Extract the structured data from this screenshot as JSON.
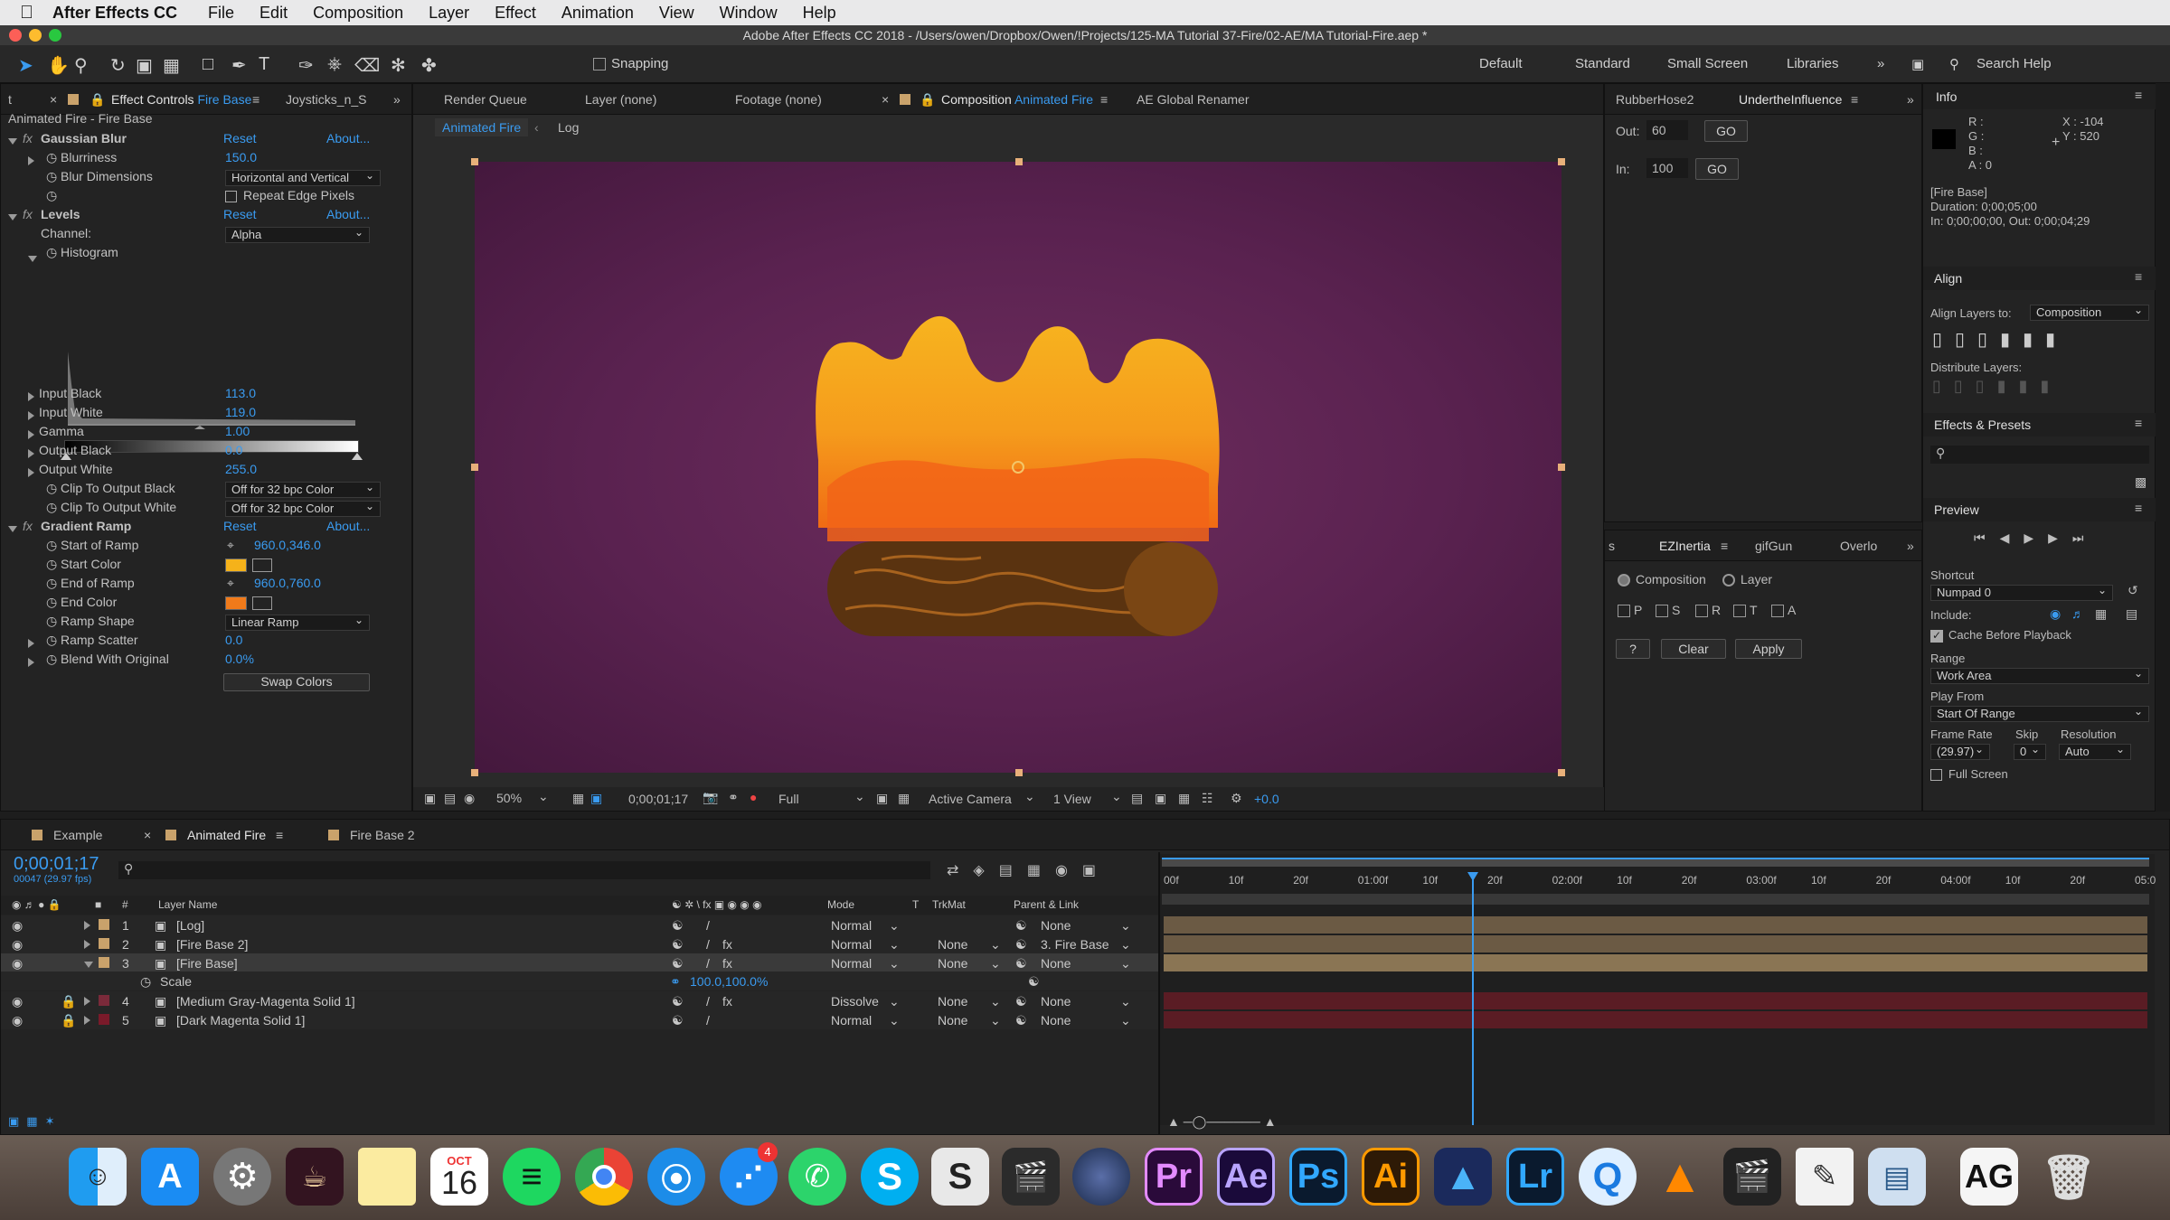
{
  "menubar": {
    "app": "After Effects CC",
    "items": [
      "File",
      "Edit",
      "Composition",
      "Layer",
      "Effect",
      "Animation",
      "View",
      "Window",
      "Help"
    ]
  },
  "titlebar": {
    "title": "Adobe After Effects CC 2018 - /Users/owen/Dropbox/Owen/!Projects/125-MA Tutorial 37-Fire/02-AE/MA Tutorial-Fire.aep *"
  },
  "toolbar": {
    "snapping": "Snapping",
    "workspaces": [
      "Default",
      "Standard",
      "Small Screen",
      "Libraries"
    ],
    "search": "Search Help"
  },
  "effects": {
    "tabs": [
      "Effect Controls",
      "Fire Base",
      "Joysticks_n_S"
    ],
    "header": "Animated Fire - Fire Base",
    "reset": "Reset",
    "about": "About...",
    "gaussian": {
      "name": "Gaussian Blur",
      "blurriness_l": "Blurriness",
      "blurriness": "150.0",
      "dims_l": "Blur Dimensions",
      "dims": "Horizontal and Vertical",
      "repeat": "Repeat Edge Pixels"
    },
    "levels": {
      "name": "Levels",
      "channel_l": "Channel:",
      "channel": "Alpha",
      "histogram": "Histogram",
      "in_black_l": "Input Black",
      "in_black": "113.0",
      "in_white_l": "Input White",
      "in_white": "119.0",
      "gamma_l": "Gamma",
      "gamma": "1.00",
      "out_black_l": "Output Black",
      "out_black": "0.0",
      "out_white_l": "Output White",
      "out_white": "255.0",
      "clip_black_l": "Clip To Output Black",
      "clip_black": "Off for 32 bpc Color",
      "clip_white_l": "Clip To Output White",
      "clip_white": "Off for 32 bpc Color"
    },
    "ramp": {
      "name": "Gradient Ramp",
      "start_l": "Start of Ramp",
      "start": "960.0,346.0",
      "start_color_l": "Start Color",
      "end_l": "End of Ramp",
      "end": "960.0,760.0",
      "end_color_l": "End Color",
      "shape_l": "Ramp Shape",
      "shape": "Linear Ramp",
      "scatter_l": "Ramp Scatter",
      "scatter": "0.0",
      "blend_l": "Blend With Original",
      "blend": "0.0%",
      "swap": "Swap Colors",
      "start_color": "#f5b21a",
      "end_color": "#f07a1a"
    }
  },
  "comp": {
    "tabs": [
      "Render Queue",
      "Layer (none)",
      "Footage (none)",
      "Composition",
      "Animated Fire",
      "AE Global Renamer"
    ],
    "breadcrumbs": [
      "Animated Fire",
      "Log"
    ],
    "footer": {
      "zoom": "50%",
      "time": "0;00;01;17",
      "res": "Full",
      "camera": "Active Camera",
      "view": "1 View",
      "exposure": "+0.0"
    }
  },
  "rubber": {
    "tabs": [
      "RubberHose2",
      "UndertheInfluence"
    ],
    "out_l": "Out:",
    "out": "60",
    "in_l": "In:",
    "in": "100",
    "go": "GO"
  },
  "ezinertia": {
    "tabs": [
      "EZInertia",
      "gifGun",
      "Overlo"
    ],
    "composition": "Composition",
    "layer": "Layer",
    "checks": [
      "P",
      "S",
      "R",
      "T",
      "A"
    ],
    "help": "?",
    "clear": "Clear",
    "apply": "Apply"
  },
  "info": {
    "title": "Info",
    "r": "R :",
    "g": "G :",
    "b": "B :",
    "a": "A : 0",
    "x": "X : -104",
    "y": "Y : 520",
    "layer": "[Fire Base]",
    "duration": "Duration: 0;00;05;00",
    "inout": "In: 0;00;00;00, Out: 0;00;04;29"
  },
  "align": {
    "title": "Align",
    "align_to_l": "Align Layers to:",
    "align_to": "Composition",
    "distribute": "Distribute Layers:"
  },
  "effects_presets": {
    "title": "Effects & Presets"
  },
  "preview": {
    "title": "Preview",
    "shortcut_l": "Shortcut",
    "shortcut": "Numpad 0",
    "include": "Include:",
    "cache": "Cache Before Playback",
    "range_l": "Range",
    "range": "Work Area",
    "play_from_l": "Play From",
    "play_from": "Start Of Range",
    "frame_rate_l": "Frame Rate",
    "skip_l": "Skip",
    "resolution_l": "Resolution",
    "frame_rate": "(29.97)",
    "skip": "0",
    "resolution": "Auto",
    "fullscreen": "Full Screen"
  },
  "timeline": {
    "tabs": [
      "Example",
      "Animated Fire",
      "Fire Base 2"
    ],
    "timecode": "0;00;01;17",
    "frames": "00047 (29.97 fps)",
    "headers": {
      "num": "#",
      "layer": "Layer Name",
      "mode": "Mode",
      "t": "T",
      "trkmat": "TrkMat",
      "parent": "Parent & Link"
    },
    "ruler": [
      "00f",
      "10f",
      "20f",
      "01:00f",
      "10f",
      "20f",
      "02:00f",
      "10f",
      "20f",
      "03:00f",
      "10f",
      "20f",
      "04:00f",
      "10f",
      "20f",
      "05:0"
    ],
    "layers": [
      {
        "num": "1",
        "name": "[Log]",
        "mode": "Normal",
        "trkmat": "",
        "parent": "None",
        "color": "#c9a26b"
      },
      {
        "num": "2",
        "name": "[Fire Base 2]",
        "mode": "Normal",
        "trkmat": "None",
        "parent": "3. Fire Base",
        "color": "#c9a26b"
      },
      {
        "num": "3",
        "name": "[Fire Base]",
        "mode": "Normal",
        "trkmat": "None",
        "parent": "None",
        "color": "#c9a26b"
      },
      {
        "num": "4",
        "name": "[Medium Gray-Magenta Solid 1]",
        "mode": "Dissolve",
        "trkmat": "None",
        "parent": "None",
        "color": "#7a2a3a"
      },
      {
        "num": "5",
        "name": "[Dark Magenta Solid 1]",
        "mode": "Normal",
        "trkmat": "None",
        "parent": "None",
        "color": "#7a1a2a"
      }
    ],
    "scale_l": "Scale",
    "scale": "100.0,100.0%"
  },
  "dock": {
    "calendar_month": "OCT",
    "calendar_day": "16",
    "mail_badge": "4",
    "icons": [
      "finder-icon",
      "app-store-icon",
      "system-preferences-icon",
      "photo-booth-icon",
      "notes-icon",
      "calendar-icon",
      "spotify-icon",
      "chrome-icon",
      "safari-icon",
      "messenger-icon",
      "whatsapp-icon",
      "skype-icon",
      "scrivener-icon",
      "final-cut-icon",
      "cinema4d-icon",
      "premiere-icon",
      "after-effects-icon",
      "photoshop-icon",
      "illustrator-icon",
      "affinity-icon",
      "lightroom-icon",
      "quicktime-icon",
      "vlc-icon",
      "claquette-icon",
      "textedit-icon",
      "preview-icon",
      "ag-icon",
      "trash-icon"
    ],
    "labels": {
      "pr": "Pr",
      "ae": "Ae",
      "ps": "Ps",
      "ai": "Ai",
      "lr": "Lr",
      "ag": "AG",
      "s": "S"
    }
  }
}
